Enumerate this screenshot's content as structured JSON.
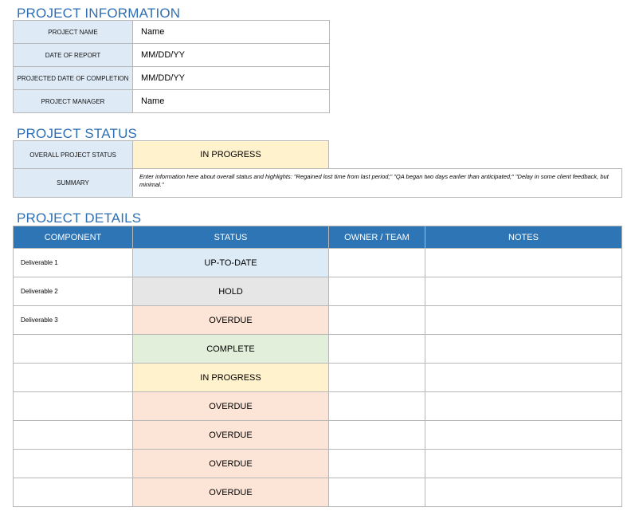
{
  "project_information": {
    "title": "PROJECT INFORMATION",
    "rows": [
      {
        "label": "PROJECT NAME",
        "value": "Name"
      },
      {
        "label": "DATE OF REPORT",
        "value": "MM/DD/YY"
      },
      {
        "label": "PROJECTED DATE OF COMPLETION",
        "value": "MM/DD/YY"
      },
      {
        "label": "PROJECT MANAGER",
        "value": "Name"
      }
    ]
  },
  "project_status": {
    "title": "PROJECT STATUS",
    "overall_label": "OVERALL PROJECT STATUS",
    "overall_value": "IN PROGRESS",
    "overall_color": "#fff2cc",
    "summary_label": "SUMMARY",
    "summary_text": "Enter information here about overall status and highlights: \"Regained lost time from last period;\" \"QA began two days earlier than anticipated;\" \"Delay in some client feedback, but minimal.\""
  },
  "project_details": {
    "title": "PROJECT DETAILS",
    "header_color": "#2e75b6",
    "columns": [
      "COMPONENT",
      "STATUS",
      "OWNER / TEAM",
      "NOTES"
    ],
    "rows": [
      {
        "component": "Deliverable 1",
        "status": "UP-TO-DATE",
        "status_color": "#ddebf7",
        "owner": "",
        "notes": ""
      },
      {
        "component": "Deliverable 2",
        "status": "HOLD",
        "status_color": "#e7e6e6",
        "owner": "",
        "notes": ""
      },
      {
        "component": "Deliverable 3",
        "status": "OVERDUE",
        "status_color": "#fce4d6",
        "owner": "",
        "notes": ""
      },
      {
        "component": "",
        "status": "COMPLETE",
        "status_color": "#e2efda",
        "owner": "",
        "notes": ""
      },
      {
        "component": "",
        "status": "IN PROGRESS",
        "status_color": "#fff2cc",
        "owner": "",
        "notes": ""
      },
      {
        "component": "",
        "status": "OVERDUE",
        "status_color": "#fce4d6",
        "owner": "",
        "notes": ""
      },
      {
        "component": "",
        "status": "OVERDUE",
        "status_color": "#fce4d6",
        "owner": "",
        "notes": ""
      },
      {
        "component": "",
        "status": "OVERDUE",
        "status_color": "#fce4d6",
        "owner": "",
        "notes": ""
      },
      {
        "component": "",
        "status": "OVERDUE",
        "status_color": "#fce4d6",
        "owner": "",
        "notes": ""
      }
    ]
  }
}
